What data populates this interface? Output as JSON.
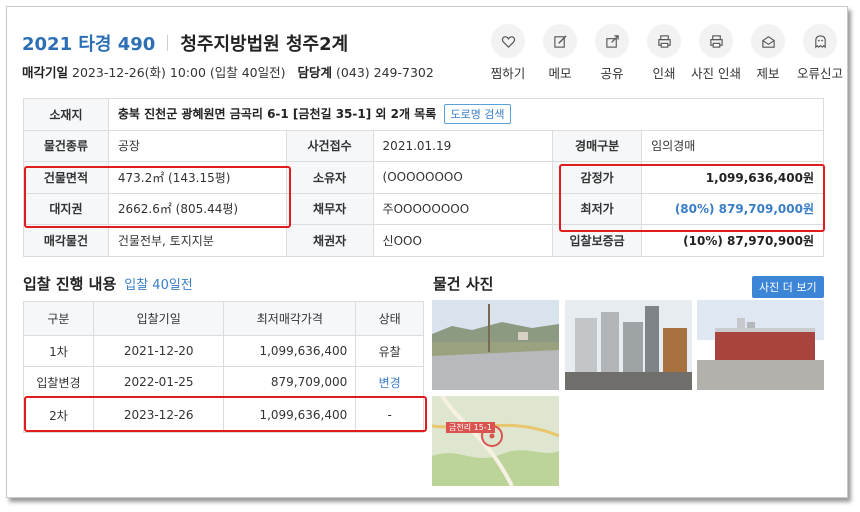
{
  "header": {
    "case_no": "2021 타경 490",
    "court": "청주지방법원 청주2계",
    "sale_date_label": "매각기일",
    "sale_date": "2023-12-26(화) 10:00 (입찰 40일전)",
    "dept_label": "담당계",
    "dept_phone": "(043) 249-7302"
  },
  "toolbar": {
    "favorite": "찜하기",
    "memo": "메모",
    "share": "공유",
    "print": "인쇄",
    "photo_print": "사진 인쇄",
    "report": "제보",
    "error_report": "오류신고"
  },
  "info": {
    "location_label": "소재지",
    "location": "충북 진천군 광혜원면 금곡리 6-1 [금천길 35-1] 외 2개 목록",
    "road_btn": "도로명 검색",
    "type_label": "물건종류",
    "type": "공장",
    "received_label": "사건접수",
    "received": "2021.01.19",
    "auction_type_label": "경매구분",
    "auction_type": "임의경매",
    "building_area_label": "건물면적",
    "building_area": "473.2㎡ (143.15평)",
    "owner_label": "소유자",
    "owner": "(OOOOOOOO",
    "appraisal_label": "감정가",
    "appraisal": "1,099,636,400원",
    "land_label": "대지권",
    "land": "2662.6㎡ (805.44평)",
    "debtor_label": "채무자",
    "debtor": "주OOOOOOOO",
    "min_price_label": "최저가",
    "min_price": "(80%) 879,709,000원",
    "sale_item_label": "매각물건",
    "sale_item": "건물전부, 토지지분",
    "creditor_label": "채권자",
    "creditor": "신OOO",
    "deposit_label": "입찰보증금",
    "deposit": "(10%) 87,970,900원"
  },
  "history": {
    "title": "입찰 진행 내용",
    "sub": "입찰 40일전",
    "headers": [
      "구분",
      "입찰기일",
      "최저매각가격",
      "상태"
    ],
    "rows": [
      {
        "round": "1차",
        "date": "2021-12-20",
        "price": "1,099,636,400",
        "status": "유찰"
      },
      {
        "round": "입찰변경",
        "date": "2022-01-25",
        "price": "879,709,000",
        "status": "변경"
      },
      {
        "round": "2차",
        "date": "2023-12-26",
        "price": "1,099,636,400",
        "status": "-"
      }
    ]
  },
  "photos": {
    "title": "물건 사진",
    "more": "사진 더 보기",
    "map_label": "금천리 15-1"
  },
  "colors": {
    "accent": "#2c6fb5",
    "link": "#3a7ec8",
    "highlight_box": "#e11c1c",
    "button": "#3d85d6"
  }
}
